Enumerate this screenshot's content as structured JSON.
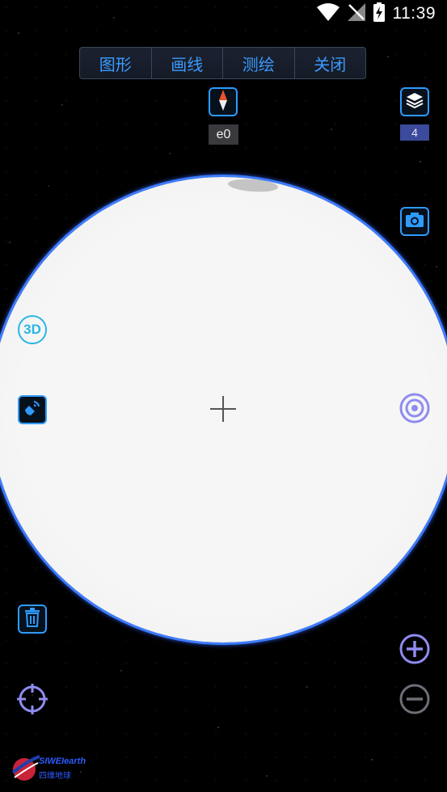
{
  "status_bar": {
    "time": "11:39",
    "icons": [
      "wifi-icon",
      "no-signal-icon",
      "battery-charging-icon"
    ]
  },
  "top_menu": {
    "items": [
      {
        "label": "图形"
      },
      {
        "label": "画线"
      },
      {
        "label": "测绘"
      },
      {
        "label": "关闭"
      }
    ]
  },
  "compass": {
    "icon": "compass-icon",
    "heading_label": "e0"
  },
  "layers": {
    "icon": "layers-icon",
    "count": "4"
  },
  "left_toolbar": {
    "mode_3d_label": "3D",
    "icons": [
      "3d-toggle-icon",
      "satellite-icon",
      "trash-icon",
      "locate-icon"
    ]
  },
  "right_toolbar": {
    "icons": [
      "camera-icon",
      "target-icon",
      "zoom-in-icon",
      "zoom-out-icon"
    ]
  },
  "logo": {
    "brand_text": "SIWEIearth",
    "sub_text": "四维地球"
  },
  "colors": {
    "accent_blue": "#2f9bff",
    "menu_text": "#3b9bff",
    "zoom_purple": "#8f8cf0",
    "globe_rim": "#3d7cff",
    "compass_needle_red": "#e8542c"
  }
}
